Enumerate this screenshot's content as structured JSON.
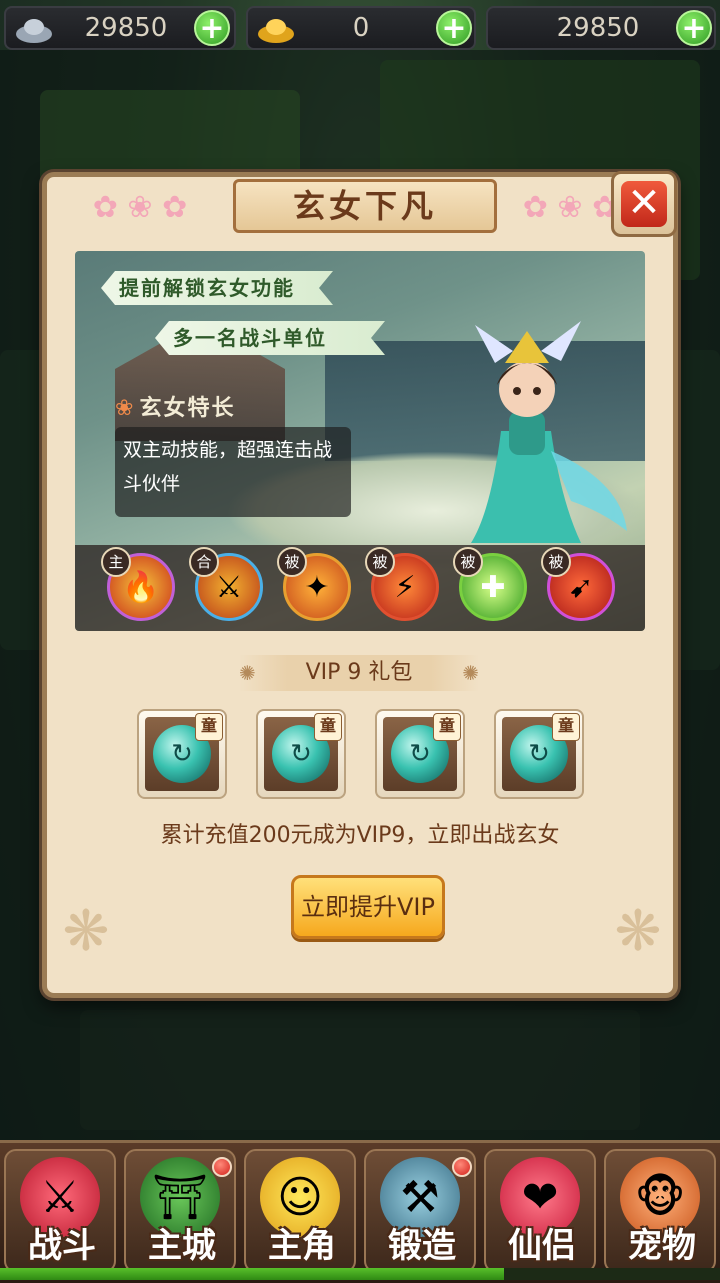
{
  "currencies": [
    {
      "icon": "silver-ingot-icon",
      "value": "29850"
    },
    {
      "icon": "gold-ingot-icon",
      "value": "0"
    },
    {
      "icon": "coin-icon",
      "value": "29850"
    }
  ],
  "dialog": {
    "title": "玄女下凡",
    "tags": [
      "提前解锁玄女功能",
      "多一名战斗单位"
    ],
    "traits_title": "玄女特长",
    "traits_text": "双主动技能，超强连击战斗伙伴",
    "skills": [
      {
        "badge": "主",
        "ring": "#c060d8"
      },
      {
        "badge": "合",
        "ring": "#4ab0e8"
      },
      {
        "badge": "被",
        "ring": "#e8a030"
      },
      {
        "badge": "被",
        "ring": "#e05030"
      },
      {
        "badge": "被",
        "ring": "#7ad040"
      },
      {
        "badge": "被",
        "ring": "#d050d8"
      }
    ],
    "vip_banner": "VIP 9 礼包",
    "reward_badge": "童",
    "rewards_count": 4,
    "note": "累计充值200元成为VIP9，立即出战玄女",
    "button": "立即提升VIP"
  },
  "nav": [
    {
      "label": "战斗",
      "icon": "battle-icon",
      "badge": false
    },
    {
      "label": "主城",
      "icon": "city-icon",
      "badge": true
    },
    {
      "label": "主角",
      "icon": "hero-icon",
      "badge": false
    },
    {
      "label": "锻造",
      "icon": "forge-icon",
      "badge": true
    },
    {
      "label": "仙侣",
      "icon": "companion-icon",
      "badge": false
    },
    {
      "label": "宠物",
      "icon": "pet-icon",
      "badge": false
    }
  ],
  "progress": 0.7
}
